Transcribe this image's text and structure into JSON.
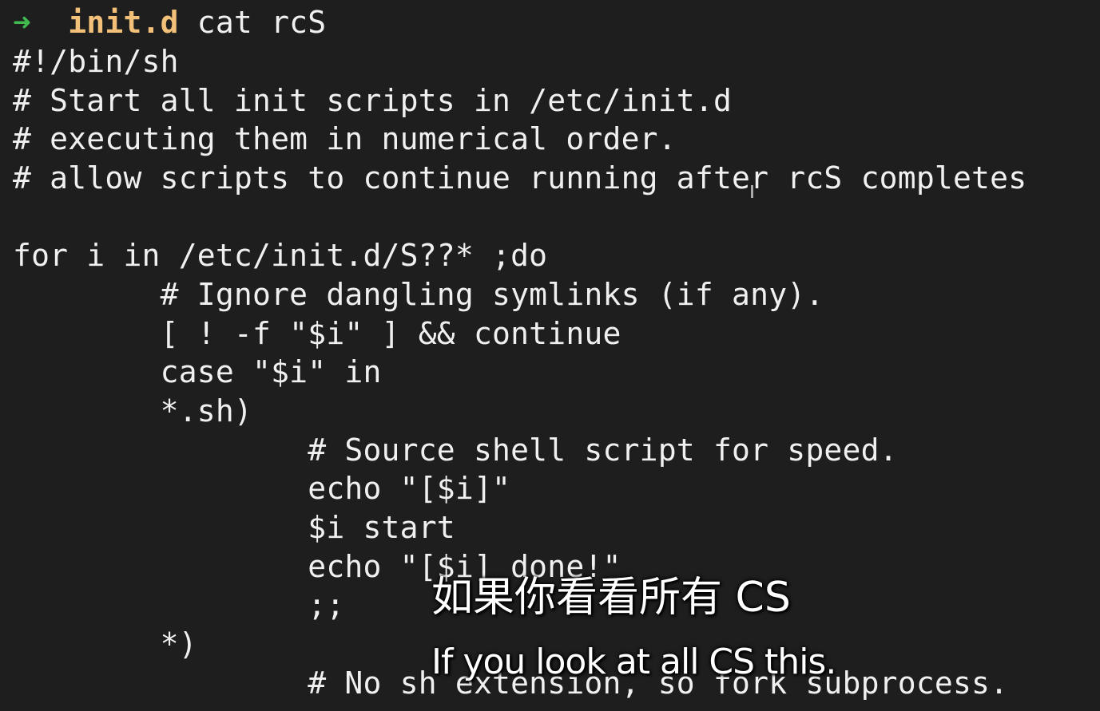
{
  "prompt": {
    "arrow": "➜",
    "directory": "init.d",
    "command": "cat rcS"
  },
  "lines": [
    "#!/bin/sh",
    "# Start all init scripts in /etc/init.d",
    "# executing them in numerical order.",
    "# allow scripts to continue running after rcS completes",
    "",
    "for i in /etc/init.d/S??* ;do",
    "        # Ignore dangling symlinks (if any).",
    "        [ ! -f \"$i\" ] && continue",
    "        case \"$i\" in",
    "        *.sh)",
    "                # Source shell script for speed.",
    "                echo \"[$i]\"",
    "                $i start",
    "                echo \"[$i] done!\"",
    "                ;;",
    "        *)",
    "                # No sh extension, so fork subprocess."
  ],
  "subtitles": {
    "chinese": "如果你看看所有 CS",
    "english": "If you look at all CS this."
  },
  "colors": {
    "background": "#1e1e1e",
    "text": "#f0f0f0",
    "prompt_arrow": "#3fb950",
    "prompt_dir": "#f2c078"
  }
}
